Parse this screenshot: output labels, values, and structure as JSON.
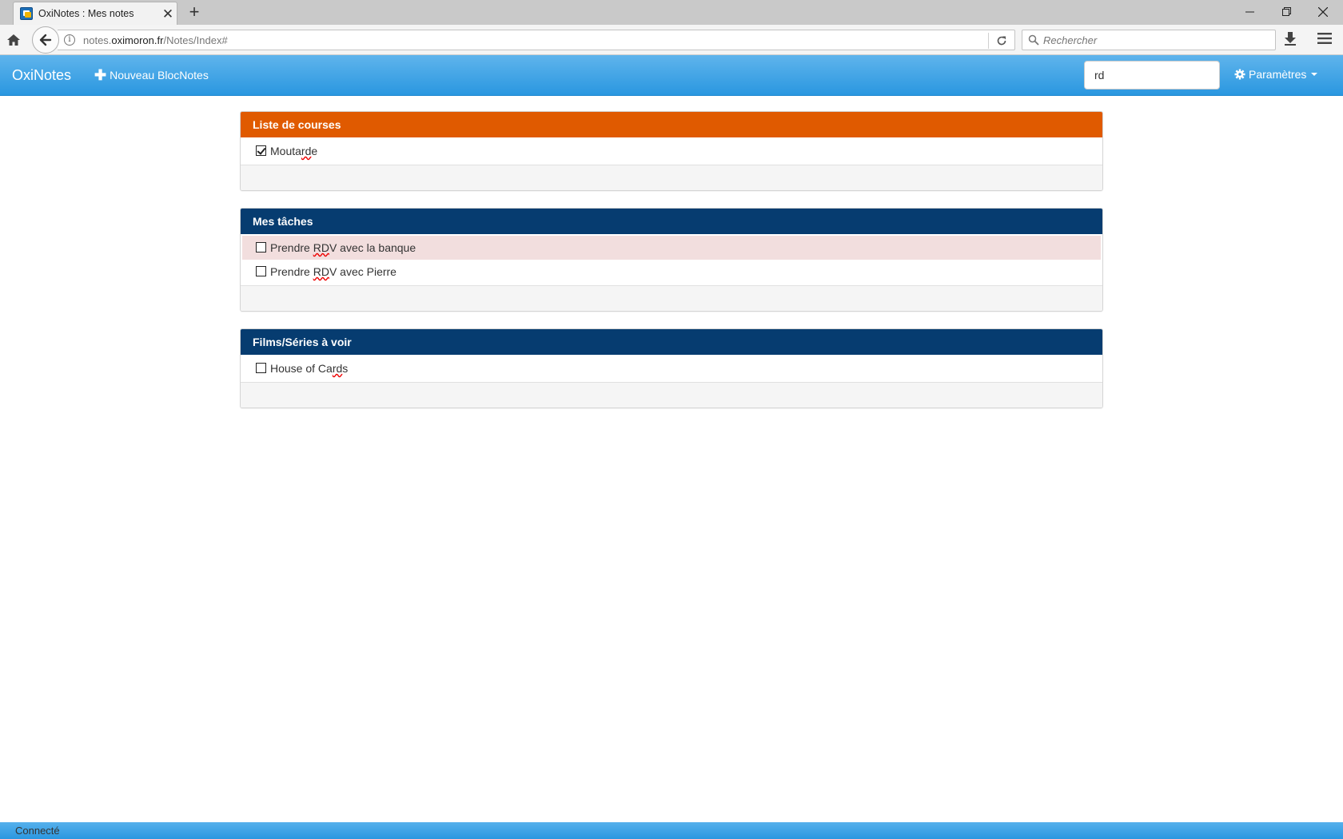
{
  "browser": {
    "tab_title": "OxiNotes : Mes notes",
    "url_prefix": "notes.",
    "url_domain": "oximoron.fr",
    "url_path": "/Notes/Index#",
    "search_placeholder": "Rechercher"
  },
  "app": {
    "brand": "OxiNotes",
    "new_note_label": "Nouveau BlocNotes",
    "search_value": "rd",
    "settings_label": "Paramètres"
  },
  "notebooks": [
    {
      "title": "Liste de courses",
      "header_color": "#e05a00",
      "items": [
        {
          "text": "Moutarde",
          "checked": true,
          "highlighted": false
        }
      ]
    },
    {
      "title": "Mes tâches",
      "header_color": "#063c70",
      "items": [
        {
          "text": "Prendre RDV avec la banque",
          "checked": false,
          "highlighted": true
        },
        {
          "text": "Prendre RDV avec Pierre",
          "checked": false,
          "highlighted": false
        }
      ]
    },
    {
      "title": "Films/Séries à voir",
      "header_color": "#063c70",
      "items": [
        {
          "text": "House of Cards",
          "checked": false,
          "highlighted": false
        }
      ]
    }
  ],
  "status": {
    "text": "Connecté"
  }
}
